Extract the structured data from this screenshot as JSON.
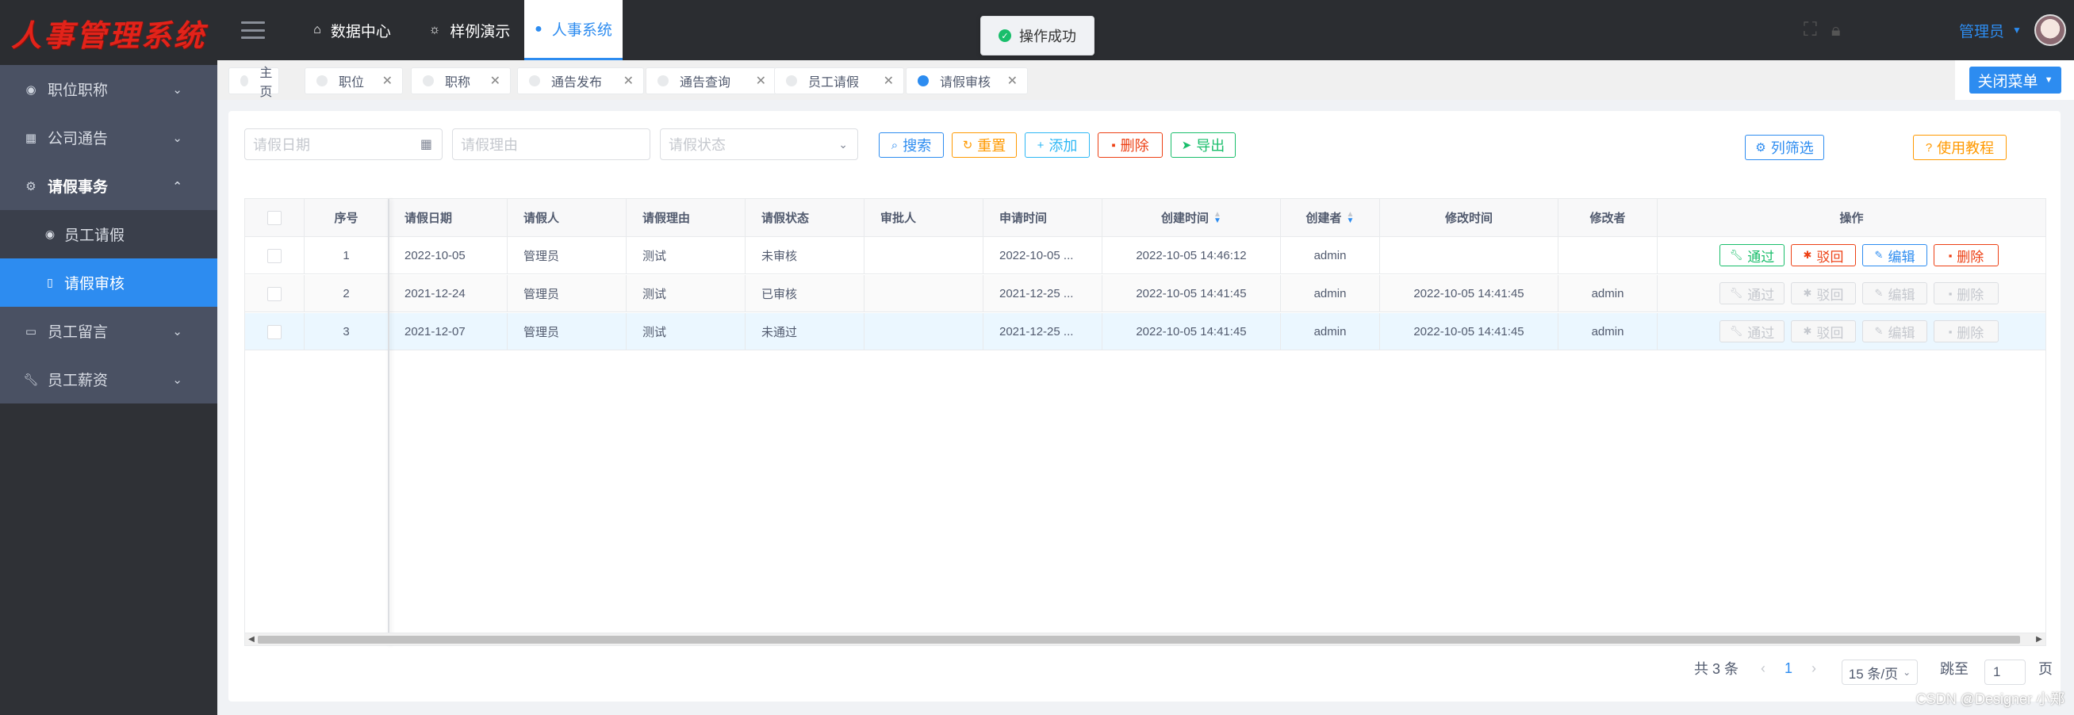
{
  "app": {
    "title": "人事管理系统"
  },
  "sidebar": {
    "items": [
      {
        "label": "职位职称",
        "icon": "person-circle-icon"
      },
      {
        "label": "公司通告",
        "icon": "grid-icon"
      },
      {
        "label": "请假事务",
        "icon": "gear-circle-icon"
      },
      {
        "label": "员工留言",
        "icon": "window-icon"
      },
      {
        "label": "员工薪资",
        "icon": "wrench-icon"
      }
    ],
    "sub_items": [
      {
        "label": "员工请假",
        "icon": "person-circle-icon"
      },
      {
        "label": "请假审核",
        "icon": "clipboard-icon"
      }
    ]
  },
  "header": {
    "tabs": [
      {
        "label": "数据中心",
        "icon": "home-icon"
      },
      {
        "label": "样例演示",
        "icon": "bulb-icon"
      },
      {
        "label": "人事系统",
        "icon": "info-circle-icon"
      }
    ],
    "user": "管理员"
  },
  "toast": {
    "message": "操作成功"
  },
  "tagbar": {
    "tags": [
      "主页",
      "职位",
      "职称",
      "通告发布",
      "通告查询",
      "员工请假",
      "请假审核"
    ],
    "close_menu": "关闭菜单"
  },
  "filters": {
    "date_placeholder": "请假日期",
    "reason_placeholder": "请假理由",
    "status_placeholder": "请假状态"
  },
  "toolbar": {
    "search": "搜索",
    "reset": "重置",
    "add": "添加",
    "delete": "删除",
    "export": "导出",
    "column_filter": "列筛选",
    "tutorial": "使用教程"
  },
  "table": {
    "headers": [
      "序号",
      "请假日期",
      "请假人",
      "请假理由",
      "请假状态",
      "审批人",
      "申请时间",
      "创建时间",
      "创建者",
      "修改时间",
      "修改者",
      "操作"
    ],
    "rows": [
      {
        "no": "1",
        "date": "2022-10-05",
        "person": "管理员",
        "reason": "测试",
        "status": "未审核",
        "approver": "",
        "apply_time": "2022-10-05 ...",
        "created": "2022-10-05 14:46:12",
        "creator": "admin",
        "modified": "",
        "modifier": ""
      },
      {
        "no": "2",
        "date": "2021-12-24",
        "person": "管理员",
        "reason": "测试",
        "status": "已审核",
        "approver": "",
        "apply_time": "2021-12-25 ...",
        "created": "2022-10-05 14:41:45",
        "creator": "admin",
        "modified": "2022-10-05 14:41:45",
        "modifier": "admin"
      },
      {
        "no": "3",
        "date": "2021-12-07",
        "person": "管理员",
        "reason": "测试",
        "status": "未通过",
        "approver": "",
        "apply_time": "2021-12-25 ...",
        "created": "2022-10-05 14:41:45",
        "creator": "admin",
        "modified": "2022-10-05 14:41:45",
        "modifier": "admin"
      }
    ],
    "ops": {
      "approve": "通过",
      "reject": "驳回",
      "edit": "编辑",
      "delete": "删除"
    }
  },
  "pagination": {
    "total": "共 3 条",
    "current_page": "1",
    "page_size": "15 条/页",
    "jump_label": "跳至",
    "jump_value": "1",
    "page_suffix": "页"
  },
  "watermark": "CSDN @Designer 小郑",
  "colors": {
    "primary": "#2d8cf0",
    "success": "#19be6b",
    "warning": "#ff9900",
    "error": "#ed4014",
    "sidebar": "#2f3136"
  }
}
